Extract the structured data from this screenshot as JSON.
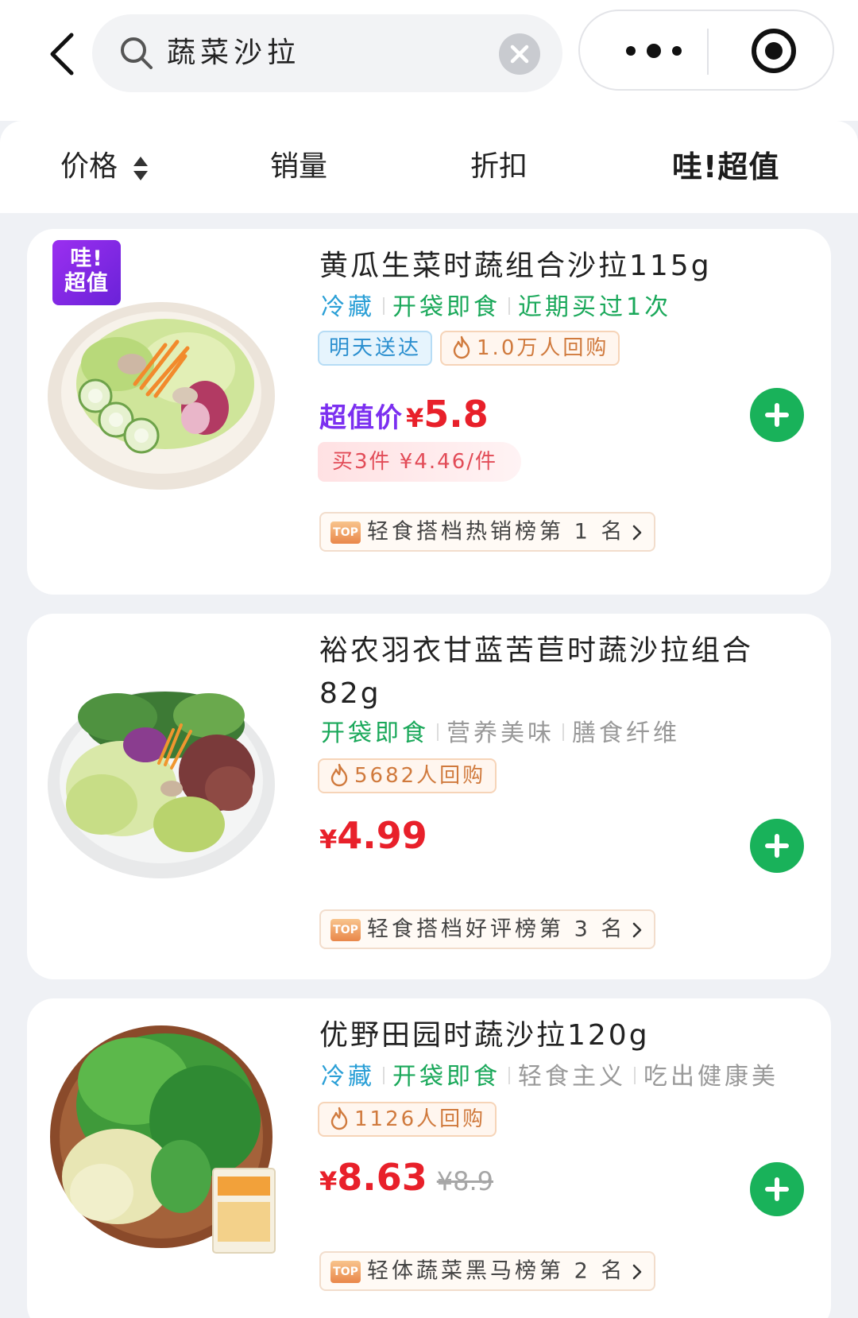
{
  "header": {
    "search_query": "蔬菜沙拉",
    "icons": [
      "back-arrow-icon",
      "search-icon",
      "clear-icon",
      "more-icon",
      "target-icon"
    ]
  },
  "sort": {
    "price": "价格",
    "sales": "销量",
    "discount": "折扣",
    "wow_value": "哇!超值"
  },
  "products": [
    {
      "badge": "哇!超值",
      "title": "黄瓜生菜时蔬组合沙拉115g",
      "tags": [
        "冷藏",
        "开袋即食",
        "近期买过1次"
      ],
      "delivery_chip": "明天送达",
      "repurchase": "1.0万人回购",
      "price_label": "超值价",
      "currency": "¥",
      "price": "5.8",
      "multi_buy": "买3件 ¥4.46/件",
      "rank": "轻食搭档热销榜第 1 名"
    },
    {
      "title": "裕农羽衣甘蓝苦苣时蔬沙拉组合82g",
      "tags": [
        "开袋即食",
        "营养美味",
        "膳食纤维"
      ],
      "repurchase": "5682人回购",
      "currency": "¥",
      "price": "4.99",
      "rank": "轻食搭档好评榜第 3 名"
    },
    {
      "title": "优野田园时蔬沙拉120g",
      "tags": [
        "冷藏",
        "开袋即食",
        "轻食主义",
        "吃出健康美"
      ],
      "repurchase": "1126人回购",
      "currency": "¥",
      "price": "8.63",
      "original_price": "¥8.9",
      "rank": "轻体蔬菜黑马榜第 2 名"
    }
  ],
  "rank_badge": "TOP",
  "colors": {
    "accent_green": "#19b25a",
    "price_red": "#e8202a",
    "wow_purple": "#7b2ff0",
    "tag_blue": "#2a9fd6",
    "tag_green": "#1aa85a"
  }
}
